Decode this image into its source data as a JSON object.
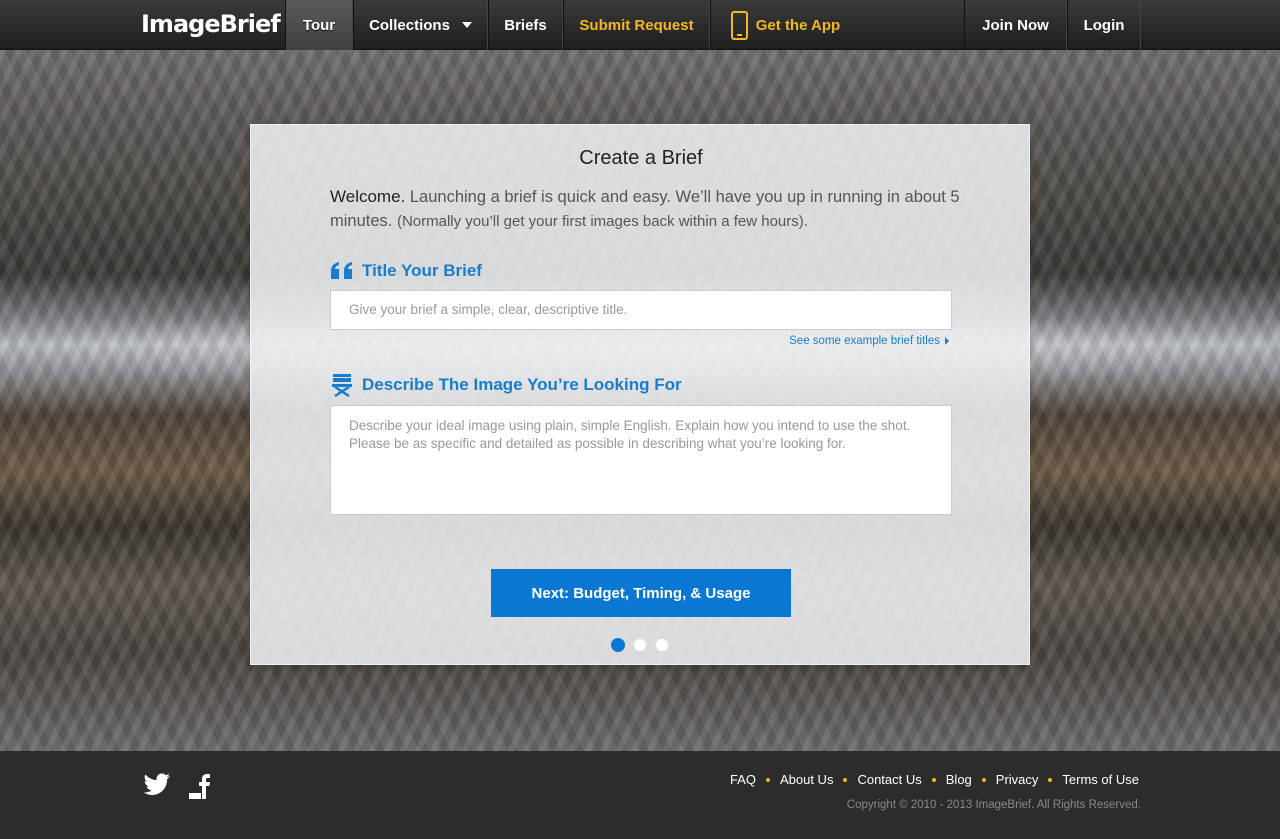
{
  "nav": {
    "logo": "ImageBrief",
    "items": [
      {
        "label": "Tour",
        "active": true
      },
      {
        "label": "Collections",
        "has_dropdown": true
      },
      {
        "label": "Briefs"
      },
      {
        "label": "Submit Request",
        "accent": "#f2b824"
      },
      {
        "label": "Get the App",
        "icon": "mobile-phone-icon",
        "accent": "#f2b824"
      }
    ],
    "right": [
      {
        "label": "Join Now"
      },
      {
        "label": "Login"
      }
    ]
  },
  "card": {
    "title": "Create a Brief",
    "intro_welcome": "Welcome.",
    "intro_text": "Launching a brief is quick and easy. We’ll have you up in running in about 5 minutes.",
    "intro_note": "(Normally you’ll get your first images back within a few hours).",
    "title_section": {
      "heading": "Title Your Brief",
      "icon": "quote-icon",
      "placeholder": "Give your brief a simple, clear, descriptive title.",
      "example_link": "See some example brief titles"
    },
    "describe_section": {
      "heading": "Describe The Image You’re Looking For",
      "icon": "director-chair-icon",
      "placeholder": "Describe your ideal image using plain, simple English. Explain how you intend to use the shot. Please be as specific and detailed as possible in describing what you’re looking for."
    },
    "next_button": "Next: Budget, Timing, & Usage",
    "steps": {
      "total": 3,
      "current": 1
    }
  },
  "footer": {
    "social": [
      "twitter-icon",
      "facebook-icon"
    ],
    "links": [
      "FAQ",
      "About Us",
      "Contact Us",
      "Blog",
      "Privacy",
      "Terms of Use"
    ],
    "copyright": "Copyright © 2010 - 2013 ImageBrief. All Rights Reserved."
  },
  "colors": {
    "accent_yellow": "#f2b824",
    "brand_blue": "#0a77d2",
    "link_blue": "#1a7ccc",
    "footer_bg": "#2c2c2c"
  }
}
